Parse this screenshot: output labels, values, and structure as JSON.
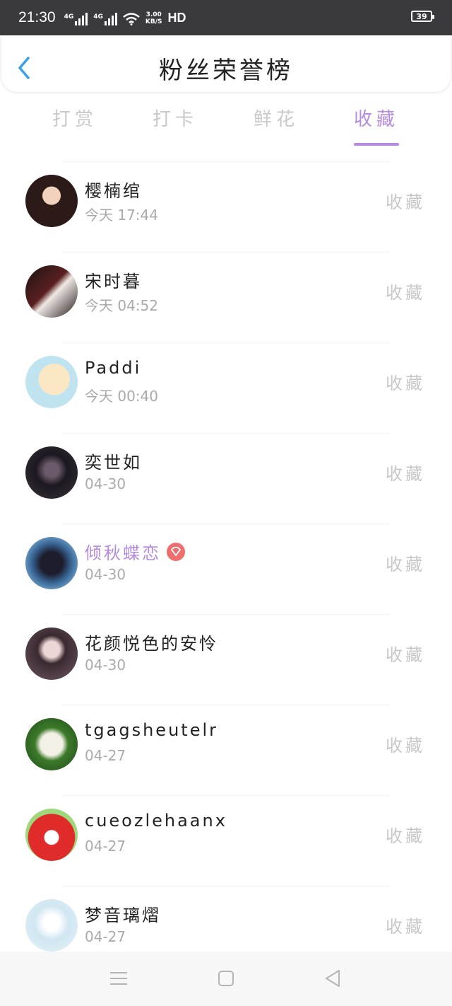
{
  "status_bar": {
    "time": "21:30",
    "net1": "4G",
    "net2": "4G",
    "speed_value": "3.00",
    "speed_unit": "KB/S",
    "hd": "HD",
    "battery": "39"
  },
  "header": {
    "title": "粉丝荣誉榜"
  },
  "tabs": [
    {
      "label": "打赏"
    },
    {
      "label": "打卡"
    },
    {
      "label": "鲜花"
    },
    {
      "label": "收藏"
    }
  ],
  "active_tab": "收藏",
  "colors": {
    "accent": "#b48be0",
    "vip_badge": "#ef6f6f",
    "status_bar": "#3a3a3c"
  },
  "list": [
    {
      "name": "樱楠绾",
      "time": "今天 17:44",
      "action": "收藏"
    },
    {
      "name": "宋时暮",
      "time": "今天 04:52",
      "action": "收藏"
    },
    {
      "name": "Paddi",
      "time": "今天 00:40",
      "action": "收藏"
    },
    {
      "name": "奕世如",
      "time": "04-30",
      "action": "收藏"
    },
    {
      "name": "倾秋蝶恋",
      "time": "04-30",
      "action": "收藏",
      "vip": true
    },
    {
      "name": "花颜悦色的安怜",
      "time": "04-30",
      "action": "收藏"
    },
    {
      "name": "tgagsheutelr",
      "time": "04-27",
      "action": "收藏"
    },
    {
      "name": "cueozlehaanx",
      "time": "04-27",
      "action": "收藏"
    },
    {
      "name": "梦音璃熠",
      "time": "04-27",
      "action": "收藏"
    }
  ]
}
